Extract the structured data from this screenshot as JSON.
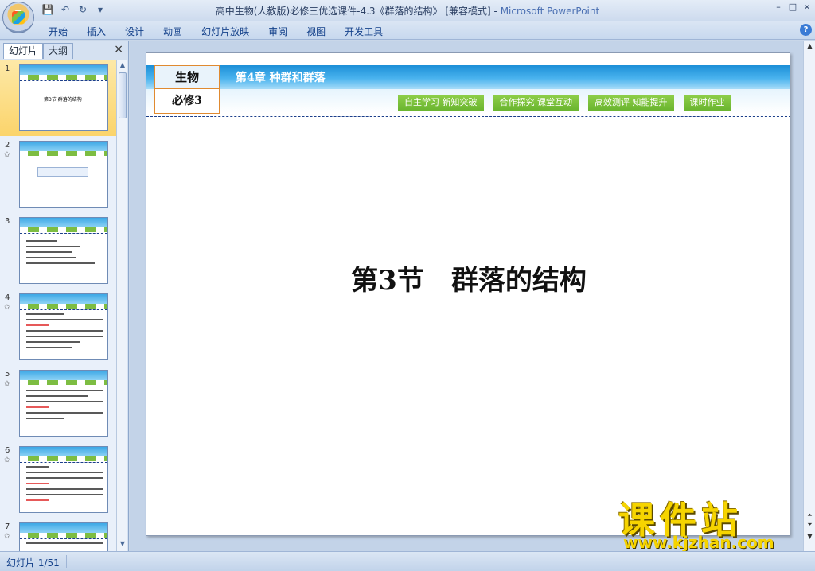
{
  "window": {
    "title": "高中生物(人教版)必修三优选课件-4.3《群落的结构》 [兼容模式] - ",
    "app_name": "Microsoft PowerPoint",
    "controls": [
      "–",
      "□",
      "×"
    ]
  },
  "qat": {
    "save_icon": "💾",
    "undo_icon": "↶",
    "redo_icon": "↻",
    "customize_icon": "▾"
  },
  "ribbon": {
    "tabs": [
      "开始",
      "插入",
      "设计",
      "动画",
      "幻灯片放映",
      "审阅",
      "视图",
      "开发工具"
    ],
    "help_icon": "?"
  },
  "left_panel": {
    "tab_slides": "幻灯片",
    "tab_outline": "大纲",
    "close_icon": "×",
    "thumbnails": [
      {
        "num": "1",
        "star": "",
        "caption": "第3节 群落的结构"
      },
      {
        "num": "2",
        "star": "✩"
      },
      {
        "num": "3",
        "star": ""
      },
      {
        "num": "4",
        "star": "✩"
      },
      {
        "num": "5",
        "star": "✩"
      },
      {
        "num": "6",
        "star": "✩"
      },
      {
        "num": "7",
        "star": "✩"
      }
    ]
  },
  "slide": {
    "subject": "生物",
    "book": "必修3",
    "chapter": "第4章  种群和群落",
    "nav_buttons": [
      "自主学习 新知突破",
      "合作探究 课堂互动",
      "高效测评 知能提升",
      "课时作业"
    ],
    "title": "第3节　群落的结构"
  },
  "watermark": {
    "name": "课件站",
    "url": "www.kjzhan.com"
  },
  "status": {
    "slide_counter": "幻灯片 1/51"
  },
  "colors": {
    "banner_blue": "#1c8fd7",
    "nav_green": "#7cc242",
    "watermark_yellow": "#f6d400",
    "selected_thumb": "#fbd46b"
  }
}
